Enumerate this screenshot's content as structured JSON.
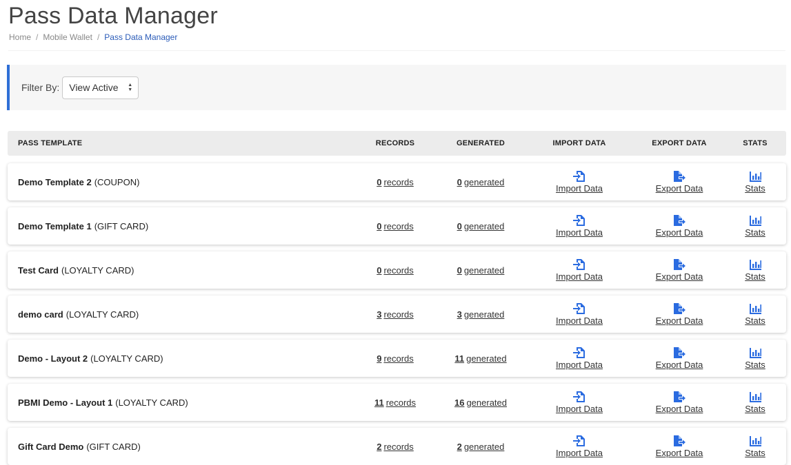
{
  "page": {
    "title": "Pass Data Manager",
    "breadcrumb": [
      "Home",
      "Mobile Wallet",
      "Pass Data Manager"
    ]
  },
  "filter": {
    "label": "Filter By:",
    "selected": "View Active"
  },
  "columns": {
    "template": "PASS TEMPLATE",
    "records": "RECORDS",
    "generated": "GENERATED",
    "import": "IMPORT DATA",
    "export": "EXPORT DATA",
    "stats": "STATS"
  },
  "actions": {
    "import_label": "Import Data",
    "export_label": "Export Data",
    "stats_label": "Stats"
  },
  "colors": {
    "accent": "#2f6fd6",
    "icon": "#2a6be0"
  },
  "icons": {
    "import": "file-import-icon",
    "export": "file-export-icon",
    "stats": "bar-chart-icon"
  },
  "rows": [
    {
      "name": "Demo Template 2",
      "type": "(COUPON)",
      "records": "0",
      "records_suffix": "records",
      "generated": "0",
      "generated_suffix": "generated"
    },
    {
      "name": "Demo Template 1",
      "type": "(GIFT CARD)",
      "records": "0",
      "records_suffix": "records",
      "generated": "0",
      "generated_suffix": "generated"
    },
    {
      "name": "Test Card",
      "type": "(LOYALTY CARD)",
      "records": "0",
      "records_suffix": "records",
      "generated": "0",
      "generated_suffix": "generated"
    },
    {
      "name": "demo card",
      "type": "(LOYALTY CARD)",
      "records": "3",
      "records_suffix": "records",
      "generated": "3",
      "generated_suffix": "generated"
    },
    {
      "name": "Demo - Layout 2",
      "type": "(LOYALTY CARD)",
      "records": "9",
      "records_suffix": "records",
      "generated": "11",
      "generated_suffix": "generated"
    },
    {
      "name": "PBMI Demo - Layout 1",
      "type": "(LOYALTY CARD)",
      "records": "11",
      "records_suffix": "records",
      "generated": "16",
      "generated_suffix": "generated"
    },
    {
      "name": "Gift Card Demo",
      "type": "(GIFT CARD)",
      "records": "2",
      "records_suffix": "records",
      "generated": "2",
      "generated_suffix": "generated"
    }
  ]
}
